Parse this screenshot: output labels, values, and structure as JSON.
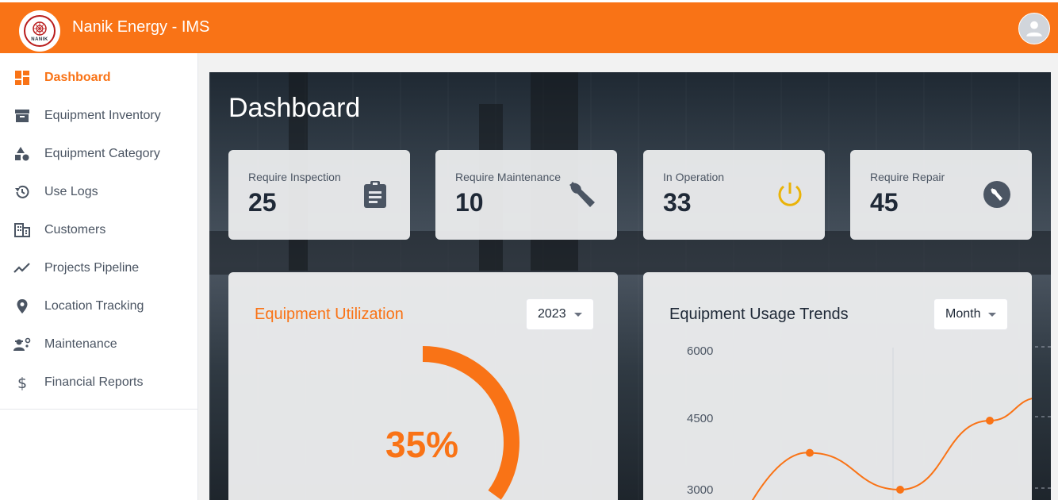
{
  "header": {
    "title": "Nanik Energy - IMS",
    "logo_text": "NANIK"
  },
  "sidebar": {
    "items": [
      {
        "label": "Dashboard",
        "icon": "dashboard-icon",
        "active": true
      },
      {
        "label": "Equipment Inventory",
        "icon": "archive-icon"
      },
      {
        "label": "Equipment Category",
        "icon": "category-icon"
      },
      {
        "label": "Use Logs",
        "icon": "history-icon"
      },
      {
        "label": "Customers",
        "icon": "building-icon"
      },
      {
        "label": "Projects Pipeline",
        "icon": "trend-icon"
      },
      {
        "label": "Location Tracking",
        "icon": "location-pin-icon"
      },
      {
        "label": "Maintenance",
        "icon": "engineer-icon"
      },
      {
        "label": "Financial Reports",
        "icon": "dollar-icon"
      }
    ]
  },
  "main": {
    "title": "Dashboard",
    "stats": [
      {
        "label": "Require Inspection",
        "value": "25",
        "icon": "clipboard-icon",
        "icon_color": "#4b5563"
      },
      {
        "label": "Require Maintenance",
        "value": "10",
        "icon": "wrench-icon",
        "icon_color": "#4b5563"
      },
      {
        "label": "In Operation",
        "value": "33",
        "icon": "power-icon",
        "icon_color": "#eab308"
      },
      {
        "label": "Require Repair",
        "value": "45",
        "icon": "repair-badge-icon",
        "icon_color": "#4b5563"
      }
    ],
    "utilization": {
      "title": "Equipment Utilization",
      "year": "2023",
      "percent_label": "35%",
      "percent": 35
    },
    "trends": {
      "title": "Equipment Usage Trends",
      "period": "Month"
    }
  },
  "colors": {
    "accent": "#f97316",
    "text": "#1f2937",
    "muted": "#4b5563"
  },
  "chart_data": {
    "type": "line",
    "title": "Equipment Usage Trends",
    "y_ticks": [
      "6000",
      "4500",
      "3000"
    ],
    "series": [
      {
        "values": [
          3800,
          3000,
          4500,
          5000
        ]
      }
    ]
  }
}
